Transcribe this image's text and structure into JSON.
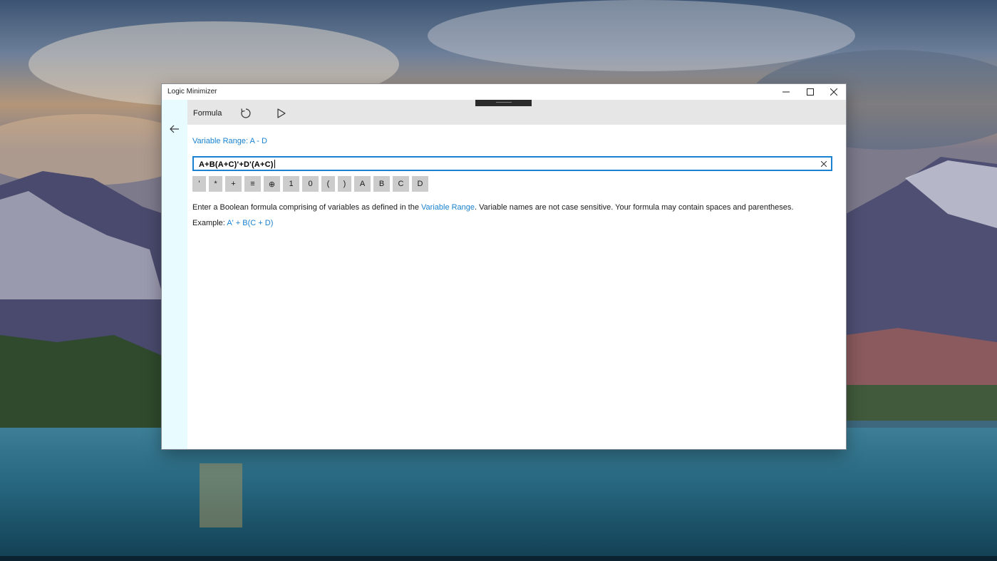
{
  "window": {
    "title": "Logic Minimizer",
    "minimize_icon": "minimize-icon",
    "maximize_icon": "maximize-icon",
    "close_icon": "close-icon"
  },
  "commandbar": {
    "title": "Formula",
    "refresh_icon": "refresh-icon",
    "run_icon": "play-icon"
  },
  "navigation": {
    "back_icon": "back-arrow-icon"
  },
  "content": {
    "variable_range_label": "Variable Range: A - D",
    "formula_value": "A+B(A+C)'+D'(A+C)",
    "clear_icon": "clear-icon",
    "keypad": [
      {
        "label": "'"
      },
      {
        "label": "*"
      },
      {
        "label": "+"
      },
      {
        "label": "≡"
      },
      {
        "label": "⊕"
      },
      {
        "label": "1"
      },
      {
        "label": "0"
      },
      {
        "label": "("
      },
      {
        "label": ")"
      },
      {
        "label": "A"
      },
      {
        "label": "B"
      },
      {
        "label": "C"
      },
      {
        "label": "D"
      }
    ],
    "help": {
      "before_link": "Enter a Boolean formula comprising of variables as defined in the ",
      "link": "Variable Range",
      "after_link": ". Variable names are not case sensitive. Your formula may contain spaces and parentheses."
    },
    "example": {
      "label": "Example: ",
      "value": "A' + B(C + D)"
    }
  },
  "colors": {
    "accent": "#1a82d0",
    "commandbar_bg": "#e6e6e6",
    "left_rail_bg": "#e8fbff",
    "key_bg": "#cccccc"
  }
}
